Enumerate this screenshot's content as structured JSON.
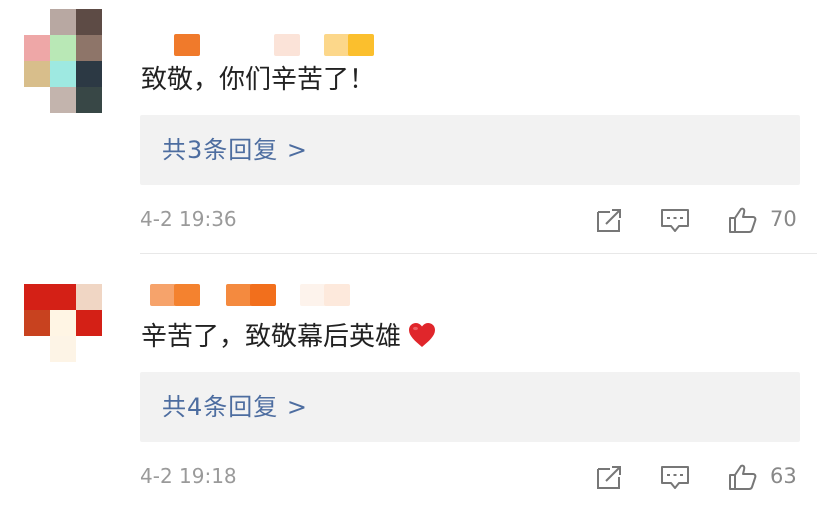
{
  "comments": [
    {
      "text": "致敬，你们辛苦了！",
      "replies_label": "共3条回复 >",
      "time": "4-2 19:36",
      "likes": "70",
      "emoji": ""
    },
    {
      "text": "辛苦了，致敬幕后英雄",
      "replies_label": "共4条回复 >",
      "time": "4-2 19:18",
      "likes": "63",
      "emoji": "red-heart"
    }
  ],
  "colors": {
    "reply_link": "#4d6da0",
    "meta_text": "#9a9a9a",
    "reply_bg": "#f2f2f2",
    "heart": "#e0262b"
  },
  "icons": [
    "share-icon",
    "comment-icon",
    "thumbs-up-icon"
  ]
}
